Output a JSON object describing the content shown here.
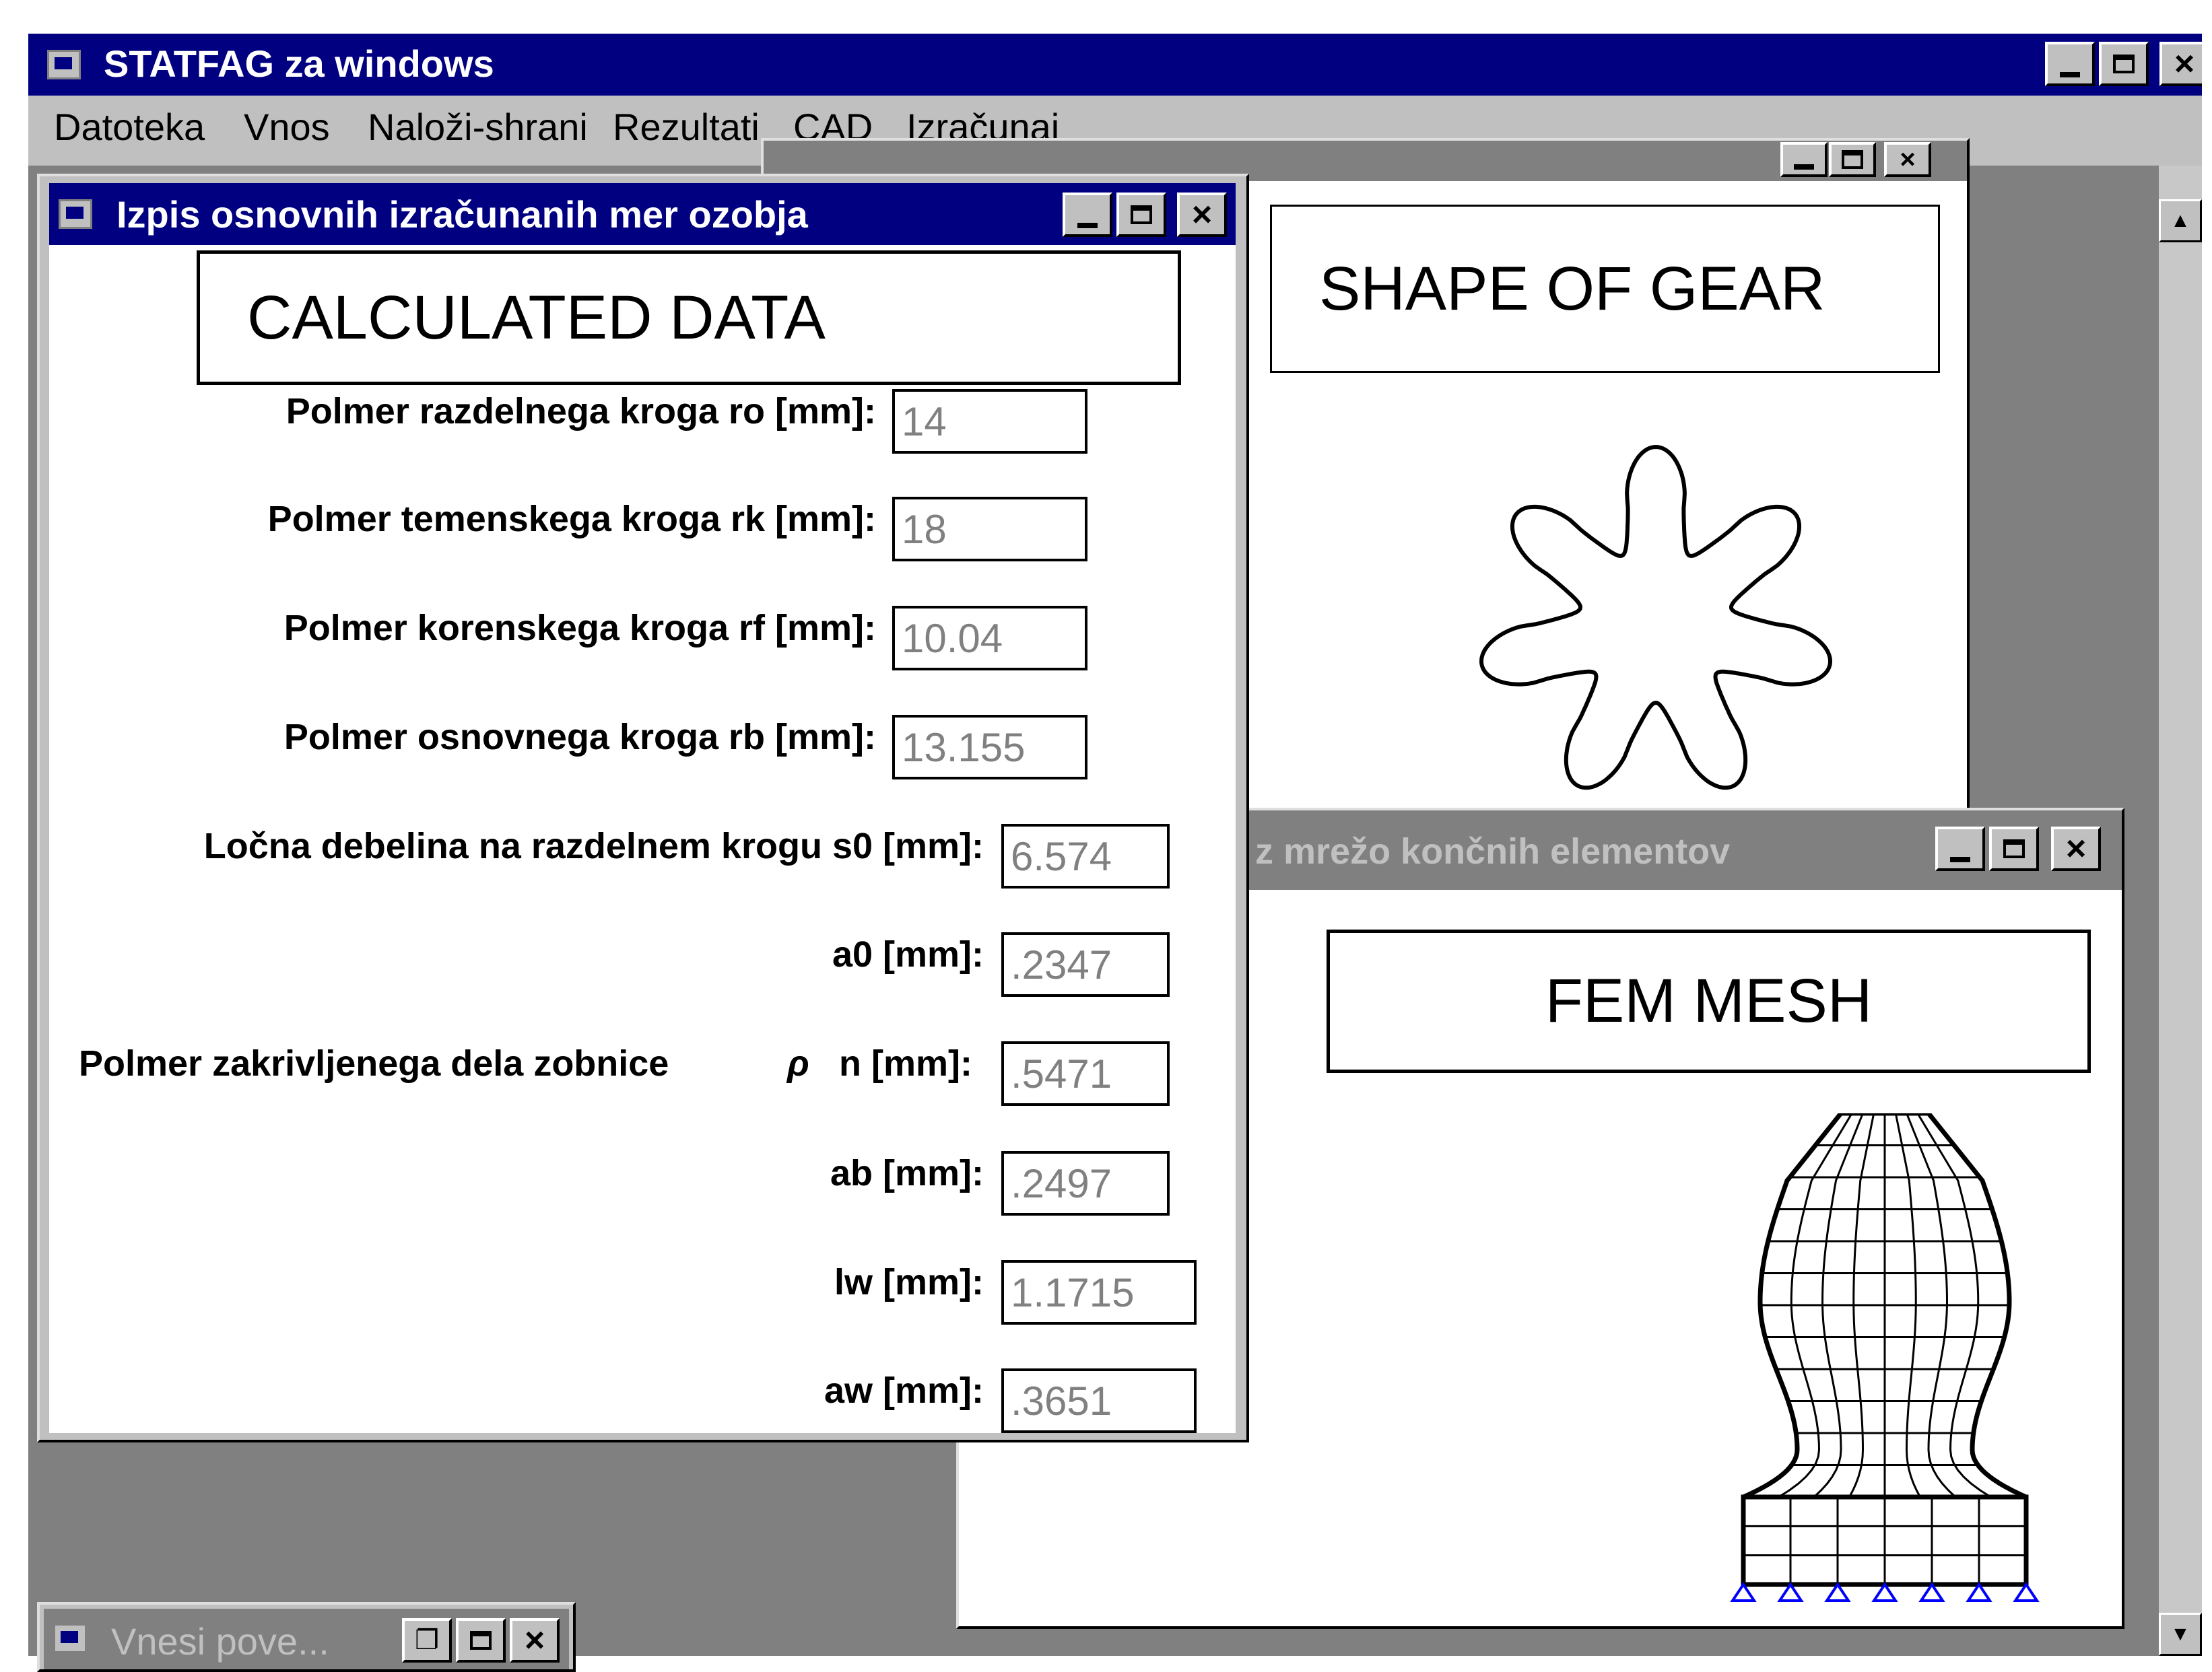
{
  "main_window": {
    "title": "STATFAG za windows",
    "menu": [
      "Datoteka",
      "Vnos",
      "Naloži-shrani",
      "Rezultati",
      "CAD",
      "Izračunaj"
    ]
  },
  "data_window": {
    "title": "Izpis osnovnih izračunanih mer ozobja",
    "heading": "CALCULATED  DATA",
    "fields": [
      {
        "label": "Polmer razdelnega kroga ro [mm]:",
        "value": "14"
      },
      {
        "label": "Polmer temenskega kroga rk [mm]:",
        "value": "18"
      },
      {
        "label": "Polmer korenskega kroga rf [mm]:",
        "value": "10.04"
      },
      {
        "label": "Polmer osnovnega kroga rb [mm]:",
        "value": "13.155"
      },
      {
        "label": "Ločna debelina na razdelnem krogu s0 [mm]:",
        "value": "6.574"
      },
      {
        "label": "a0 [mm]:",
        "value": ".2347"
      },
      {
        "label": "Polmer zakrivljenega dela zobnice",
        "symbol": "ρ",
        "suffix": "n [mm]:",
        "value": ".5471"
      },
      {
        "label": "ab [mm]:",
        "value": ".2497"
      },
      {
        "label": "lw [mm]:",
        "value": "1.1715"
      },
      {
        "label": "aw [mm]:",
        "value": ".3651"
      }
    ]
  },
  "gear_window": {
    "heading": "SHAPE OF GEAR"
  },
  "fem_window": {
    "title": "z mrežo  končnih elementov",
    "heading": "FEM MESH"
  },
  "minimized_window": {
    "title": "Vnesi pove..."
  }
}
